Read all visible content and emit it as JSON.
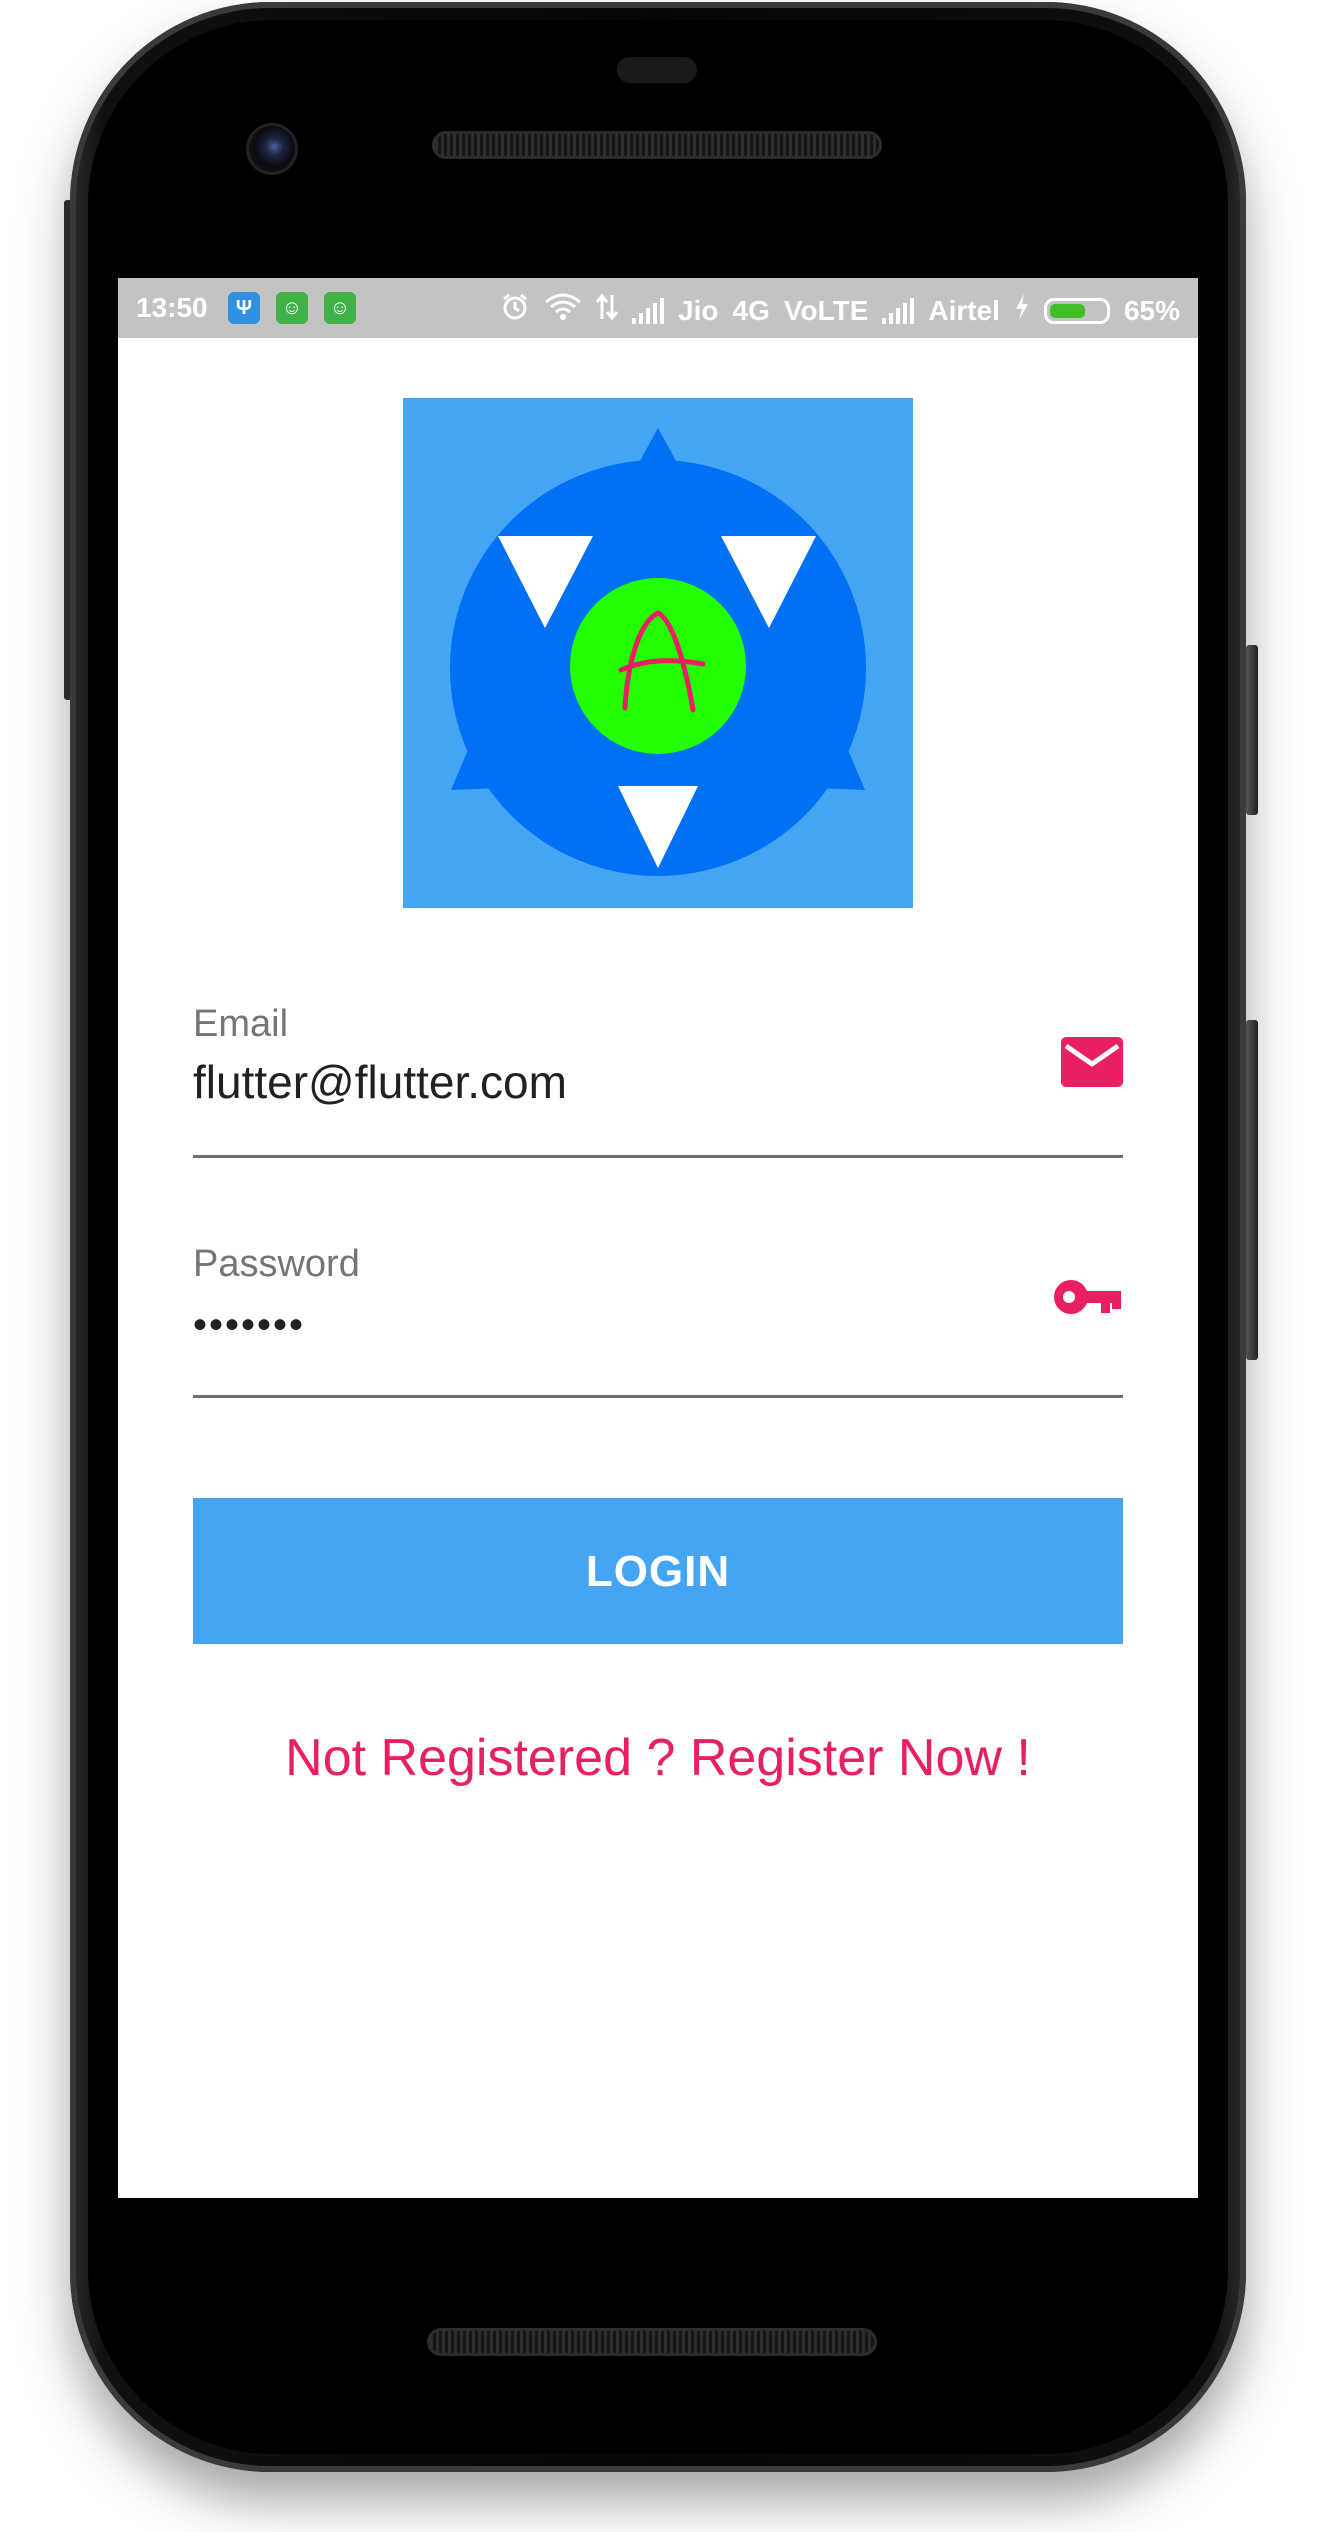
{
  "status_bar": {
    "time": "13:50",
    "carrier1": "Jio",
    "network_type": "4G",
    "volte": "VoLTE",
    "carrier2": "Airtel",
    "battery_percent": "65%",
    "battery_level": 0.65,
    "notification_icons": [
      "usb-icon",
      "app-notification-icon",
      "app-notification-icon"
    ],
    "system_icons": [
      "alarm-icon",
      "wifi-icon",
      "data-transfer-icon",
      "signal-icon",
      "charging-icon",
      "battery-icon"
    ]
  },
  "logo": {
    "letter": "A",
    "background_color": "#44a5f5",
    "circle_color": "#0070f5",
    "center_color": "#22ff00",
    "letter_color": "#e91e63"
  },
  "form": {
    "email": {
      "label": "Email",
      "value": "flutter@flutter.com",
      "icon": "mail-icon"
    },
    "password": {
      "label": "Password",
      "value": "•••••••",
      "icon": "key-icon"
    }
  },
  "login_button": {
    "label": "LOGIN",
    "color": "#44a5f5"
  },
  "register_link": {
    "label": "Not Registered ? Register Now !",
    "color": "#e91e63"
  }
}
